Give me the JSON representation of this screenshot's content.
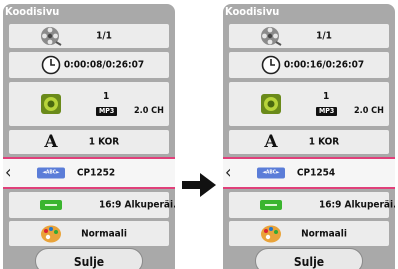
{
  "panels": [
    {
      "title": "Koodisivu",
      "angle": "1/1",
      "time": "0:00:08/0:26:07",
      "audio": {
        "number": "1",
        "codec": "MP3",
        "channels": "2.0 CH"
      },
      "subtitle": "1 KOR",
      "code_page": "CP1252",
      "aspect": "16:9 Alkuperäi...",
      "picture_mode": "Normaali",
      "close_label": "Sulje",
      "abc_label": "◄ABC►"
    },
    {
      "title": "Koodisivu",
      "angle": "1/1",
      "time": "0:00:16/0:26:07",
      "audio": {
        "number": "1",
        "codec": "MP3",
        "channels": "2.0 CH"
      },
      "subtitle": "1 KOR",
      "code_page": "CP1254",
      "aspect": "16:9 Alkuperäi...",
      "picture_mode": "Normaali",
      "close_label": "Sulje",
      "abc_label": "◄ABC►"
    }
  ],
  "colors": {
    "panel_bg": "#a9a9a9",
    "row_bg": "#ececec",
    "selection": "#e0407a",
    "abc_blue": "#5b7dd8",
    "aspect_green": "#3ab52e"
  },
  "icons": [
    "film-reel-icon",
    "clock-icon",
    "speaker-icon",
    "font-icon",
    "abc-codepage-icon",
    "aspect-ratio-icon",
    "palette-icon",
    "chevron-left-icon",
    "arrow-right-icon"
  ]
}
